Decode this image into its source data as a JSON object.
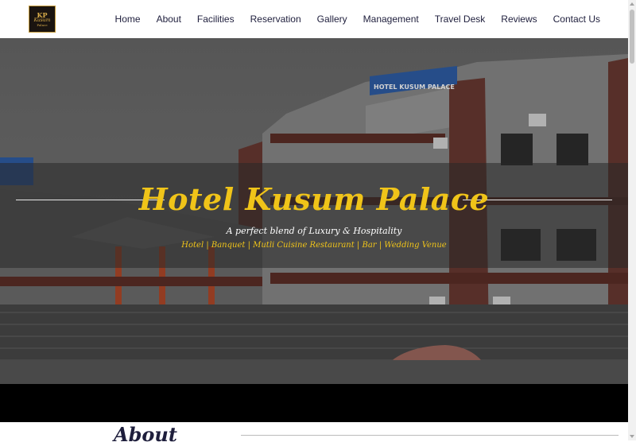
{
  "logo": {
    "monogram": "KP",
    "name": "Kusum",
    "sub": "Palace"
  },
  "nav": {
    "items": [
      {
        "label": "Home"
      },
      {
        "label": "About"
      },
      {
        "label": "Facilities"
      },
      {
        "label": "Reservation"
      },
      {
        "label": "Gallery"
      },
      {
        "label": "Management"
      },
      {
        "label": "Travel Desk"
      },
      {
        "label": "Reviews"
      },
      {
        "label": "Contact Us"
      }
    ]
  },
  "hero": {
    "title": "Hotel Kusum Palace",
    "tagline": "A perfect blend of Luxury & Hospitality",
    "services": "Hotel | Banquet | Mutli Cuisine Restaurant | Bar | Wedding Venue",
    "sign_text": "HOTEL KUSUM PALACE"
  },
  "about": {
    "title": "About"
  },
  "colors": {
    "accent": "#f0c419",
    "nav_text": "#1e1e3c",
    "band": "rgba(40,40,40,0.55)"
  }
}
